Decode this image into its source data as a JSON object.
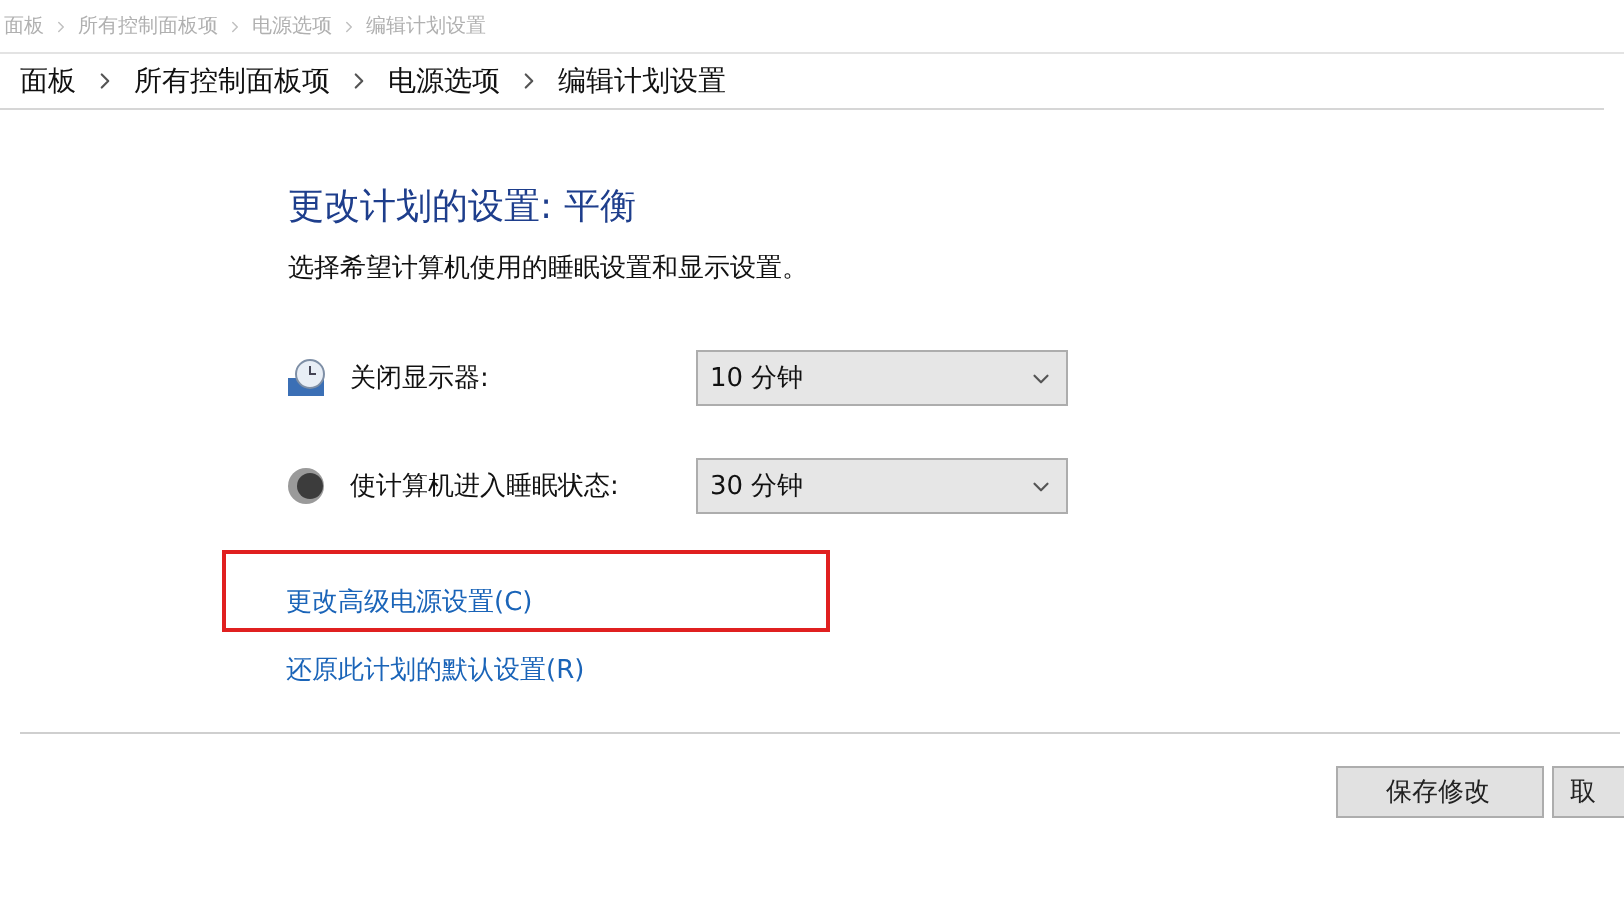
{
  "title_bar": {
    "breadcrumb": [
      "面板",
      "所有控制面板项",
      "电源选项",
      "编辑计划设置"
    ]
  },
  "address_bar": {
    "breadcrumb": [
      "面板",
      "所有控制面板项",
      "电源选项",
      "编辑计划设置"
    ]
  },
  "heading": "更改计划的设置: 平衡",
  "description": "选择希望计算机使用的睡眠设置和显示设置。",
  "settings": [
    {
      "kind": "display",
      "label": "关闭显示器:",
      "value": "10 分钟"
    },
    {
      "kind": "sleep",
      "label": "使计算机进入睡眠状态:",
      "value": "30 分钟"
    }
  ],
  "links": [
    {
      "label": "更改高级电源设置(C)",
      "highlighted": true
    },
    {
      "label": "还原此计划的默认设置(R)",
      "highlighted": false
    }
  ],
  "buttons": [
    {
      "label": "保存修改",
      "kind": "primary"
    },
    {
      "label": "取",
      "kind": "secondary"
    }
  ]
}
